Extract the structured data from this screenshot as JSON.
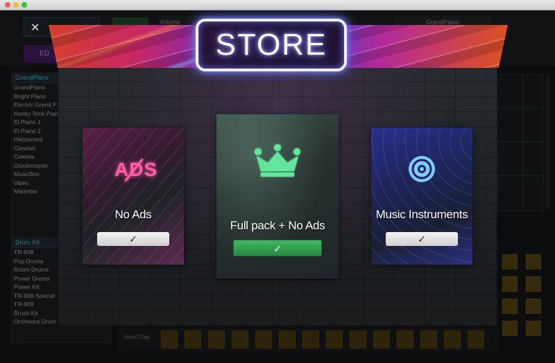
{
  "background_app": {
    "volume_label": "Volume",
    "preset_label": "GrandPiano",
    "edit_button": "ED",
    "instrument_panel": {
      "header": "GrandPiano",
      "items": [
        "GrandPiano",
        "Bright Piano",
        "Electric Grand P",
        "Honky Tonk Pian",
        "El.Piano 1",
        "El.Piano 2",
        "Harpsicord",
        "Clavinet",
        "Celesta",
        "Glockenspiel",
        "MusicBox",
        "Vibes",
        "Marimba"
      ],
      "more_indicator": "V"
    },
    "drum_panel": {
      "header": "Drum Kit",
      "items": [
        "TR-808",
        "Pop Drums",
        "Room Drums",
        "Power Drums",
        "Power Kit",
        "TR-909-Special",
        "TR-909",
        "Brush Kit",
        "Orchestra Drum"
      ]
    },
    "track_label": "Hand Clap"
  },
  "store": {
    "title": "STORE",
    "close_glyph": "✕",
    "cards": [
      {
        "title": "No Ads",
        "icon": "no-ads-icon",
        "icon_text": "ADS",
        "button_glyph": "✓"
      },
      {
        "title": "Full pack + No Ads",
        "icon": "crown-icon",
        "button_glyph": "✓"
      },
      {
        "title": "Music Instruments",
        "icon": "disc-icon",
        "button_glyph": "✓"
      }
    ],
    "colors": {
      "accent_pink": "#ff5fa8",
      "accent_green": "#5fe89a",
      "accent_blue": "#7ec8ff",
      "buy_green": "#2ea04f"
    }
  }
}
